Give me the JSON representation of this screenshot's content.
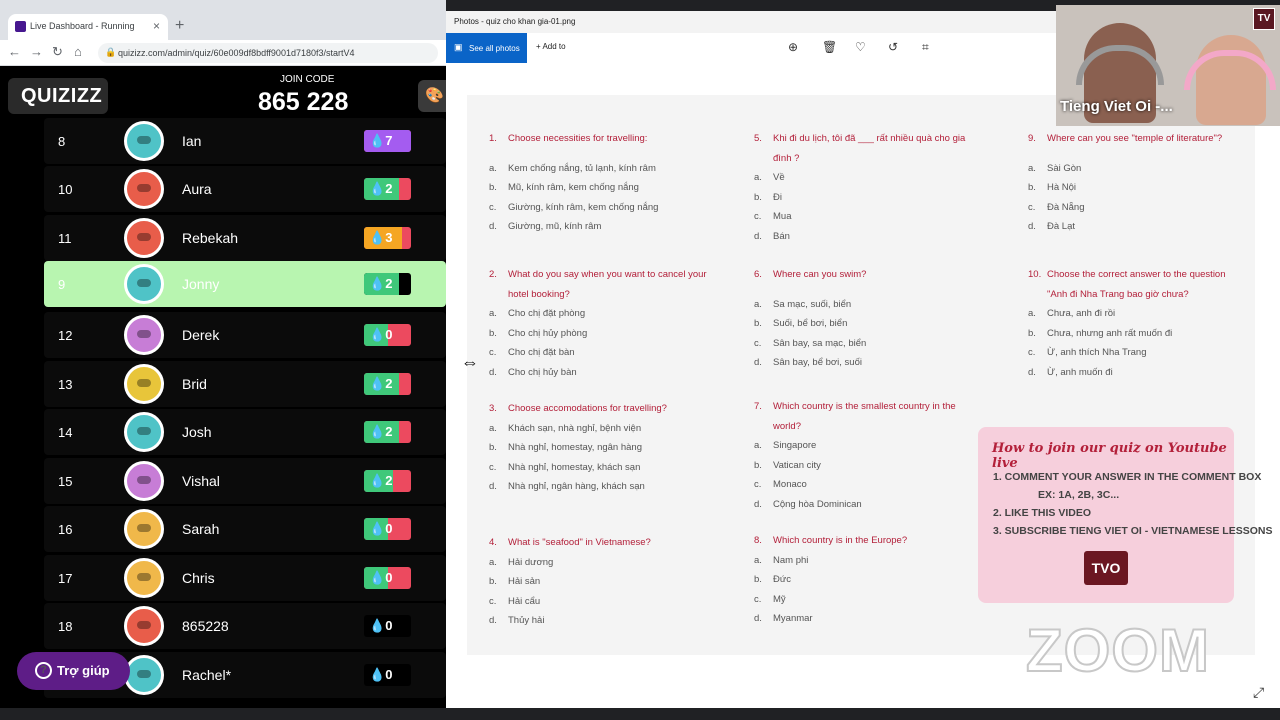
{
  "browser": {
    "tab_title": "Live Dashboard - Running",
    "url": "quizizz.com/admin/quiz/60e009df8bdff9001d7180f3/startV4"
  },
  "quizizz": {
    "logo": "QUIZIZZ",
    "join_label": "JOIN CODE",
    "join_code": "865 228",
    "help_label": "Trợ giúp",
    "players": [
      {
        "rank": "8",
        "name": "Ian",
        "score": "7",
        "fill": 1.0,
        "color": "#a45cf0",
        "avatar": "#4fc3c7"
      },
      {
        "rank": "10",
        "name": "Aura",
        "score": "2",
        "fill": 0.75,
        "color": "#3fc87a",
        "avatar": "#e85d4a"
      },
      {
        "rank": "11",
        "name": "Rebekah",
        "score": "3",
        "fill": 0.8,
        "color": "#f5a623",
        "avatar": "#e85d4a"
      },
      {
        "rank": "9",
        "name": "Jonny",
        "score": "2",
        "fill": 0.75,
        "color": "#3fc87a",
        "avatar": "#4fc3c7",
        "highlight": true
      },
      {
        "rank": "12",
        "name": "Derek",
        "score": "0",
        "fill": 0.5,
        "color": "#3fc87a",
        "avatar": "#c77dd6"
      },
      {
        "rank": "13",
        "name": "Brid",
        "score": "2",
        "fill": 0.75,
        "color": "#3fc87a",
        "avatar": "#e8c53a"
      },
      {
        "rank": "14",
        "name": "Josh",
        "score": "2",
        "fill": 0.75,
        "color": "#3fc87a",
        "avatar": "#4fc3c7"
      },
      {
        "rank": "15",
        "name": "Vishal",
        "score": "2",
        "fill": 0.62,
        "color": "#3fc87a",
        "avatar": "#c77dd6"
      },
      {
        "rank": "16",
        "name": "Sarah",
        "score": "0",
        "fill": 0.5,
        "color": "#3fc87a",
        "avatar": "#f0b84a"
      },
      {
        "rank": "17",
        "name": "Chris",
        "score": "0",
        "fill": 0.5,
        "color": "#3fc87a",
        "avatar": "#f0b84a"
      },
      {
        "rank": "18",
        "name": "865228",
        "score": "0",
        "fill": 0,
        "color": "#000000",
        "avatar": "#e85d4a"
      },
      {
        "rank": "",
        "name": "Rachel*",
        "score": "0",
        "fill": 0,
        "color": "#000000",
        "avatar": "#4fc3c7"
      }
    ]
  },
  "photos": {
    "title": "Photos - quiz cho khan gia-01.png",
    "see_all": "See all photos",
    "add_to": "Add to"
  },
  "quiz": {
    "questions": [
      {
        "num": "1.",
        "text": "Choose necessities for travelling:",
        "options": [
          [
            "a.",
            "Kem chống nắng, tủ lạnh, kính râm"
          ],
          [
            "b.",
            "Mũ, kính râm, kem chống nắng"
          ],
          [
            "c.",
            "Giường, kính râm, kem chống nắng"
          ],
          [
            "d.",
            "Giường, mũ, kính râm"
          ]
        ]
      },
      {
        "num": "2.",
        "text": "What do you say when you want to cancel your hotel booking?",
        "options": [
          [
            "a.",
            "Cho chị đặt phòng"
          ],
          [
            "b.",
            "Cho chị hủy phòng"
          ],
          [
            "c.",
            "Cho chị đặt bàn"
          ],
          [
            "d.",
            "Cho chị hủy bàn"
          ]
        ]
      },
      {
        "num": "3.",
        "text": "Choose accomodations for travelling?",
        "options": [
          [
            "a.",
            "Khách sạn, nhà nghỉ, bệnh viện"
          ],
          [
            "b.",
            "Nhà nghỉ, homestay, ngân hàng"
          ],
          [
            "c.",
            "Nhà nghỉ, homestay, khách sạn"
          ],
          [
            "d.",
            "Nhà nghỉ, ngân hàng, khách sạn"
          ]
        ]
      },
      {
        "num": "4.",
        "text": "What is \"seafood\" in Vietnamese?",
        "options": [
          [
            "a.",
            "Hải dương"
          ],
          [
            "b.",
            "Hải sản"
          ],
          [
            "c.",
            "Hải cẩu"
          ],
          [
            "d.",
            "Thủy hải"
          ]
        ]
      },
      {
        "num": "5.",
        "text": "Khi đi du lịch, tôi đã ___ rất nhiều quà cho gia đình ?",
        "options": [
          [
            "a.",
            "Về"
          ],
          [
            "b.",
            "Đi"
          ],
          [
            "c.",
            "Mua"
          ],
          [
            "d.",
            "Bán"
          ]
        ]
      },
      {
        "num": "6.",
        "text": "Where can you swim?",
        "options": [
          [
            "a.",
            "Sa mạc, suối, biển"
          ],
          [
            "b.",
            "Suối, bể bơi, biển"
          ],
          [
            "c.",
            "Sân bay, sa mạc, biển"
          ],
          [
            "d.",
            "Sân bay, bể bơi, suối"
          ]
        ]
      },
      {
        "num": "7.",
        "text": "Which country is the smallest country in the world?",
        "options": [
          [
            "a.",
            "Singapore"
          ],
          [
            "b.",
            "Vatican city"
          ],
          [
            "c.",
            "Monaco"
          ],
          [
            "d.",
            "Cộng hòa Dominican"
          ]
        ]
      },
      {
        "num": "8.",
        "text": "Which country is in the Europe?",
        "options": [
          [
            "a.",
            "Nam phi"
          ],
          [
            "b.",
            "Đức"
          ],
          [
            "c.",
            "Mỹ"
          ],
          [
            "d.",
            "Myanmar"
          ]
        ]
      },
      {
        "num": "9.",
        "text": "Where can you see \"temple of literature\"?",
        "options": [
          [
            "a.",
            "Sài Gòn"
          ],
          [
            "b.",
            "Hà Nội"
          ],
          [
            "c.",
            "Đà Nẵng"
          ],
          [
            "d.",
            "Đà Lạt"
          ]
        ]
      },
      {
        "num": "10.",
        "text": "Choose the correct answer to the question \"Anh đi Nha Trang bao giờ chưa?",
        "options": [
          [
            "a.",
            "Chưa, anh đi rồi"
          ],
          [
            "b.",
            "Chưa, nhưng anh rất muốn đi"
          ],
          [
            "c.",
            "Ừ, anh thích Nha Trang"
          ],
          [
            "d.",
            "Ừ, anh muốn đi"
          ]
        ]
      }
    ],
    "howto": {
      "title": "How to join our quiz on Youtube live",
      "line1": "1. COMMENT YOUR ANSWER IN THE COMMENT BOX",
      "line1b": "EX: 1A, 2B, 3C...",
      "line2": "2. LIKE THIS VIDEO",
      "line3": "3. SUBSCRIBE TIENG VIET OI - VIETNAMESE LESSONS"
    }
  },
  "zoom_watermark": "ZOOM",
  "webcam": {
    "name": "Tieng Viet Oi -..."
  }
}
